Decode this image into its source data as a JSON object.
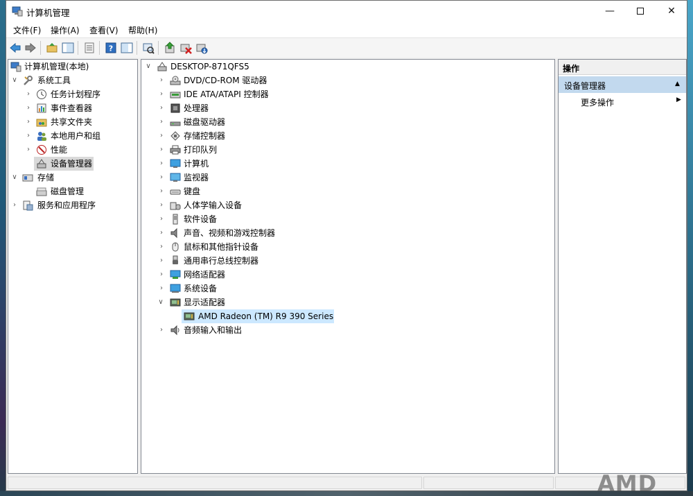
{
  "window": {
    "title": "计算机管理",
    "controls": {
      "minimize": "—",
      "close": "✕"
    }
  },
  "menu": [
    "文件(F)",
    "操作(A)",
    "查看(V)",
    "帮助(H)"
  ],
  "left_tree": {
    "root": "计算机管理(本地)",
    "system_tools": "系统工具",
    "items": [
      "任务计划程序",
      "事件查看器",
      "共享文件夹",
      "本地用户和组",
      "性能",
      "设备管理器"
    ],
    "storage": "存储",
    "disk_mgmt": "磁盘管理",
    "services": "服务和应用程序"
  },
  "device_tree": {
    "computer": "DESKTOP-871QFS5",
    "categories": [
      "DVD/CD-ROM 驱动器",
      "IDE ATA/ATAPI 控制器",
      "处理器",
      "磁盘驱动器",
      "存储控制器",
      "打印队列",
      "计算机",
      "监视器",
      "键盘",
      "人体学输入设备",
      "软件设备",
      "声音、视频和游戏控制器",
      "鼠标和其他指针设备",
      "通用串行总线控制器",
      "网络适配器",
      "系统设备",
      "显示适配器"
    ],
    "gpu": "AMD Radeon (TM) R9 390 Series",
    "audio": "音频输入和输出"
  },
  "actions": {
    "header": "操作",
    "section": "设备管理器",
    "more": "更多操作"
  },
  "watermark": "AMD"
}
